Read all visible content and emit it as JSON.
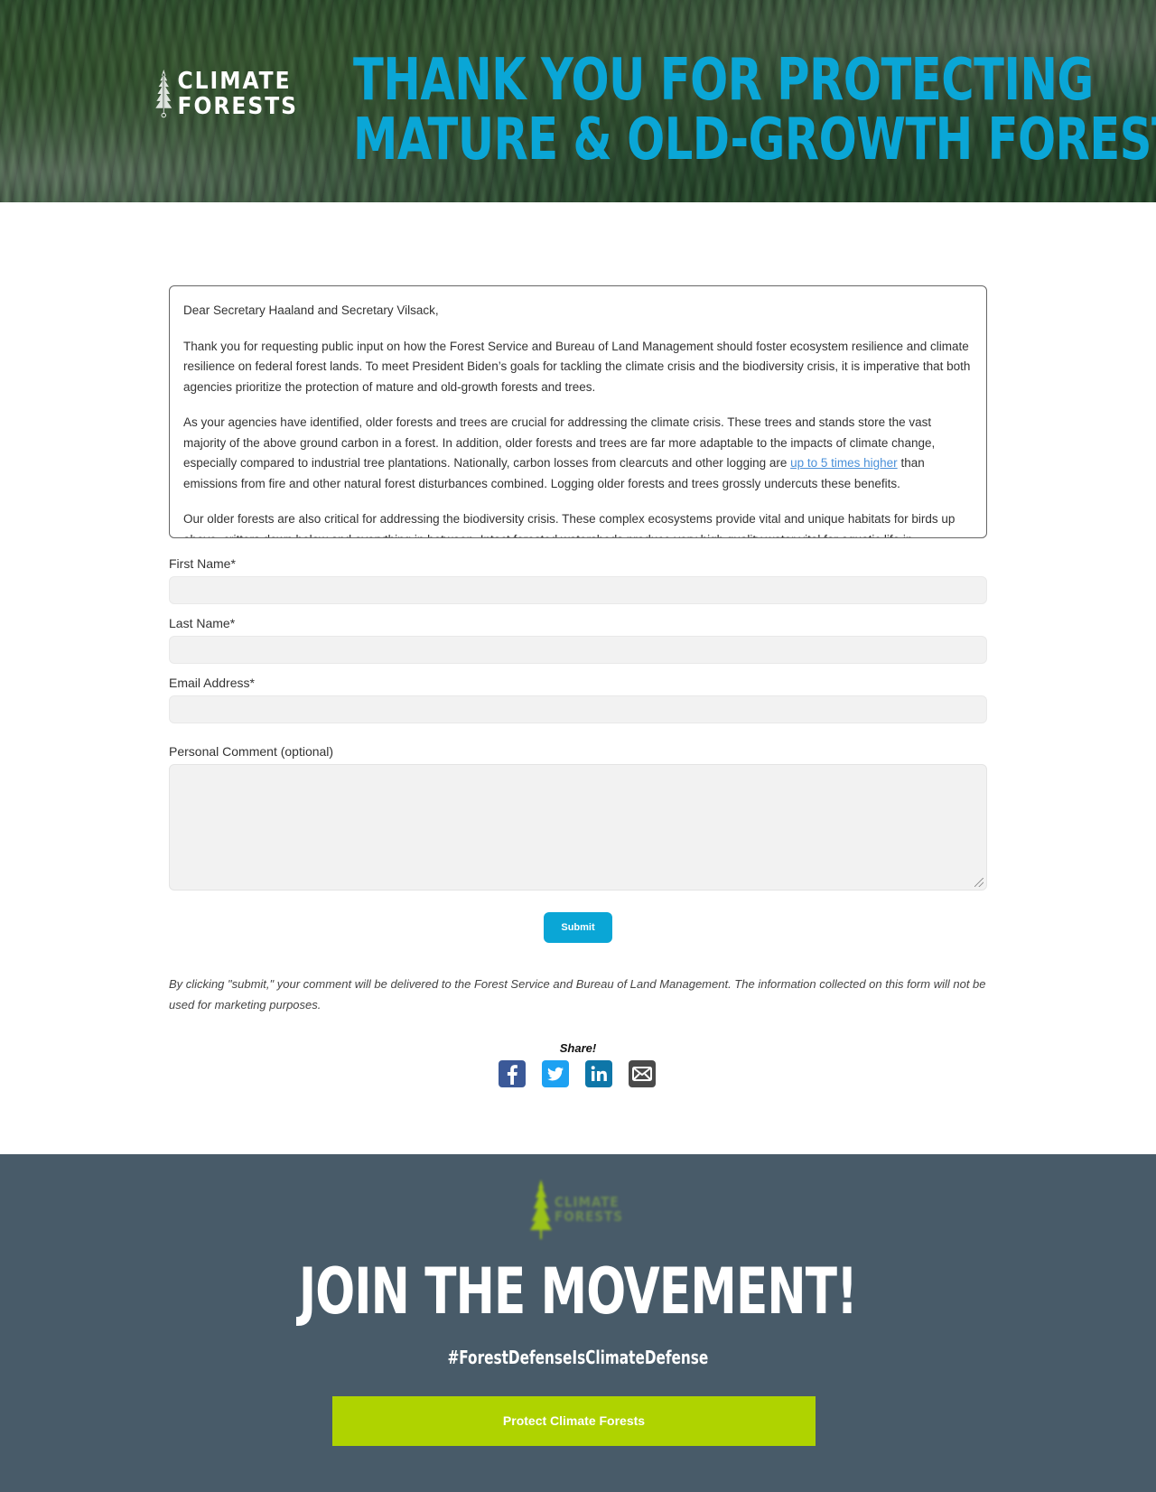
{
  "hero": {
    "logo_line1": "CLIMATE",
    "logo_line2": "FORESTS",
    "title_line1": "THANK YOU FOR PROTECTING",
    "title_line2": "MATURE & OLD-GROWTH FORESTS"
  },
  "letter": {
    "salutation": "Dear Secretary Haaland and Secretary Vilsack,",
    "p1": "Thank you for requesting public input on how the Forest Service and Bureau of Land Management should foster ecosystem resilience and climate resilience on federal forest lands. To meet President Biden’s goals for tackling the climate crisis and the biodiversity crisis, it is imperative that both agencies prioritize the protection of mature and old-growth forests and trees.",
    "p2_before_link": "As your agencies have identified, older forests and trees are crucial for addressing the climate crisis. These trees and stands store the vast majority of the above ground carbon in a forest. In addition, older forests and trees are far more adaptable to the impacts of climate change, especially compared to industrial tree plantations. Nationally, carbon losses from clearcuts and other logging are ",
    "p2_link": "up to 5 times higher",
    "p2_after_link": " than emissions from fire and other natural forest disturbances combined. Logging older forests and trees grossly undercuts these benefits.",
    "p3": "Our older forests are also critical for addressing the biodiversity crisis. These complex ecosystems provide vital and unique habitats for birds up above, critters down below and everything in between. Intact forested watersheds produce very high quality water vital for aquatic life in"
  },
  "form": {
    "first_name_label": "First Name*",
    "last_name_label": "Last Name*",
    "email_label": "Email Address*",
    "comment_label": "Personal Comment (optional)",
    "submit_label": "Submit"
  },
  "disclaimer": "By clicking \"submit,\" your comment will be delivered to the Forest Service and Bureau of Land Management. The information collected on this form will not be used for marketing purposes.",
  "share": {
    "label": "Share!",
    "icons": [
      "facebook-icon",
      "twitter-icon",
      "linkedin-icon",
      "email-icon"
    ]
  },
  "footer": {
    "logo_line1": "CLIMATE",
    "logo_line2": "FORESTS",
    "heading": "JOIN THE MOVEMENT!",
    "hashtag": "#ForestDefenseIsClimateDefense",
    "cta_label": "Protect Climate Forests"
  },
  "colors": {
    "accent_blue": "#0aa6d6",
    "footer_bg": "#485b69",
    "cta_green": "#afd300",
    "facebook": "#3b5998",
    "twitter": "#1da1f2",
    "linkedin": "#0e76a8",
    "email": "#4a4a4a"
  }
}
